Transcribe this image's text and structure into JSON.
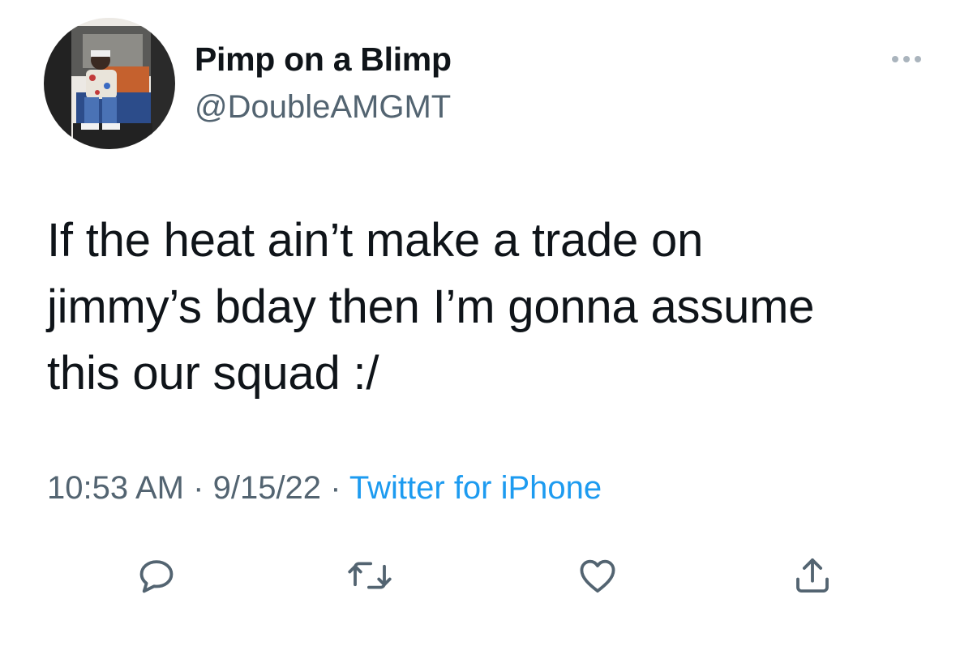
{
  "author": {
    "display_name": "Pimp on a Blimp",
    "handle": "@DoubleAMGMT"
  },
  "tweet": {
    "text_lines": [
      "If the heat ain’t make a trade on",
      "jimmy’s bday then I’m gonna assume",
      "this our squad :/"
    ],
    "time": "10:53 AM",
    "date": "9/15/22",
    "separator": "·",
    "source": "Twitter for iPhone"
  },
  "icons": {
    "more": "more-horizontal-icon",
    "reply": "reply-icon",
    "retweet": "retweet-icon",
    "like": "heart-icon",
    "share": "share-icon"
  },
  "colors": {
    "text": "#0f1419",
    "secondary": "#536471",
    "link": "#1d9bf0",
    "icon": "#536471"
  }
}
